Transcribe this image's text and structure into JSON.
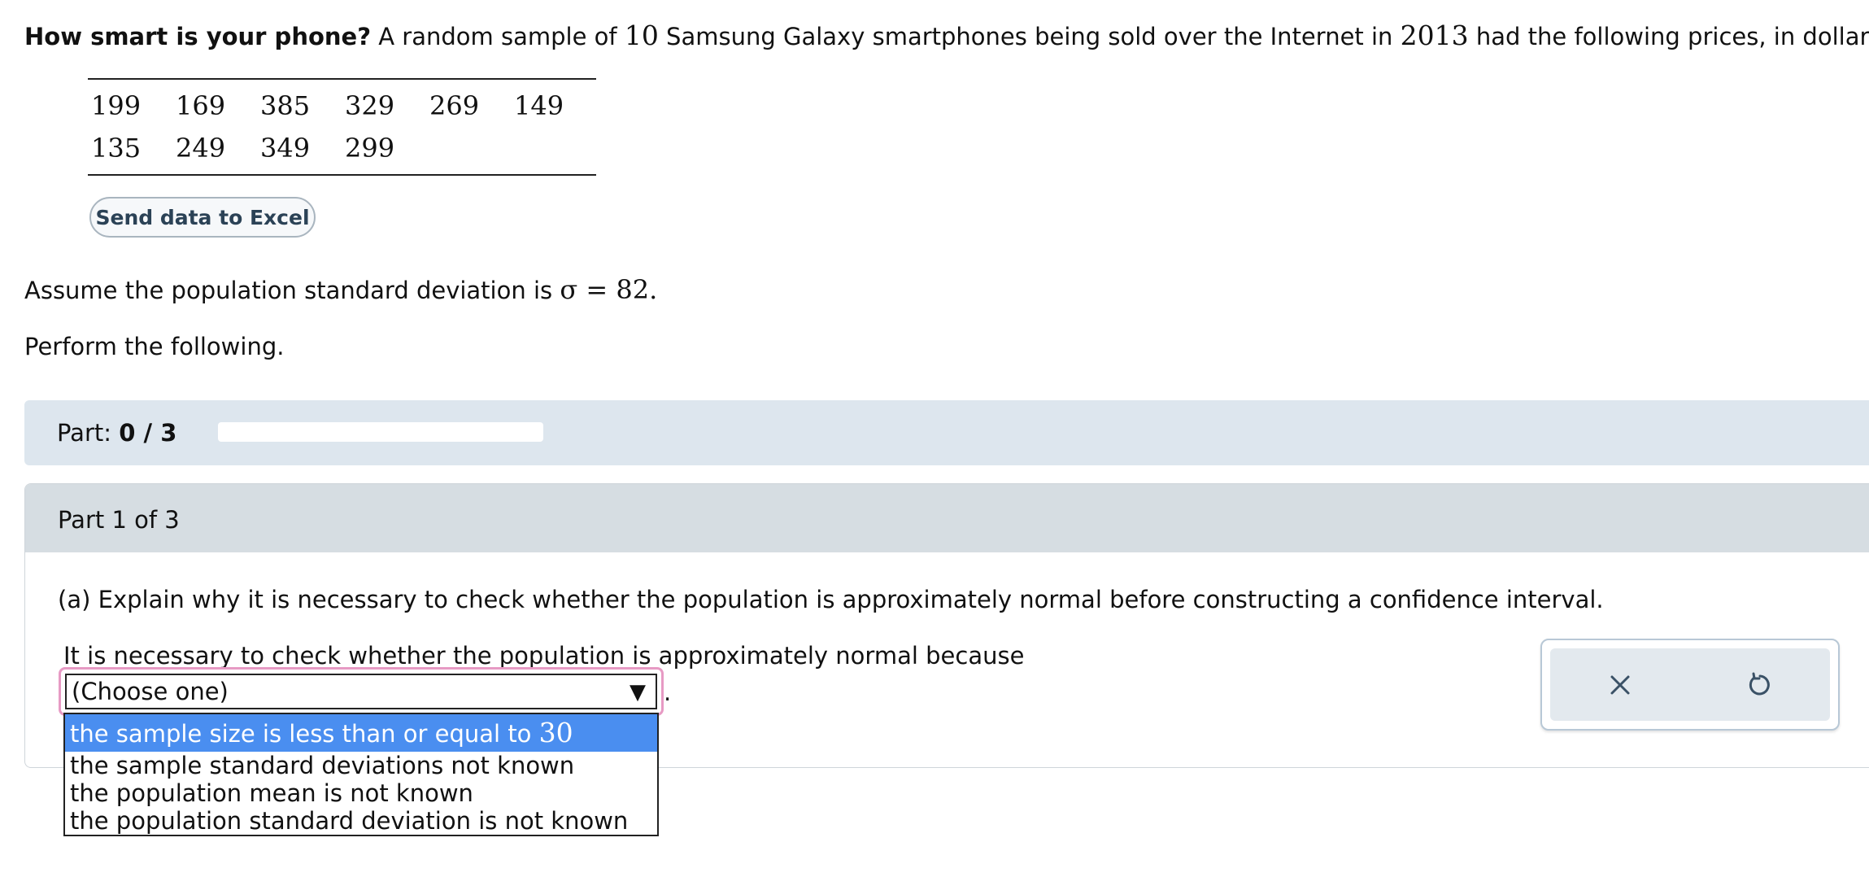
{
  "intro": {
    "bold": "How smart is your phone?",
    "text1": " A random sample of ",
    "n": "10",
    "text2": " Samsung Galaxy smartphones being sold over the Internet in ",
    "year": "2013",
    "text3": " had the following prices, in dollars:"
  },
  "prices": {
    "row1": [
      "199",
      "169",
      "385",
      "329",
      "269",
      "149"
    ],
    "row2": [
      "135",
      "249",
      "349",
      "299"
    ]
  },
  "excel_button": "Send data to Excel",
  "assume": {
    "text": "Assume the population standard deviation is ",
    "sigma": "σ = 82."
  },
  "perform": "Perform the following.",
  "part_progress": {
    "label": "Part:",
    "value": "0 / 3",
    "fraction": 0
  },
  "panel": {
    "title": "Part 1 of 3",
    "question": "(a) Explain why it is necessary to check whether the population is approximately normal before constructing a confidence interval.",
    "statement": "It is necessary to check whether the population is approximately normal because",
    "select_value": "(Choose one)",
    "after_select": ".",
    "options": [
      {
        "text": "the sample size is less than or equal to ",
        "num": "30"
      },
      {
        "text": "the sample standard deviations not known"
      },
      {
        "text": "the population mean is not known"
      },
      {
        "text": "the population standard deviation is not known"
      }
    ]
  },
  "tools": {
    "clear_icon": "close-icon",
    "reset_icon": "undo-icon"
  }
}
